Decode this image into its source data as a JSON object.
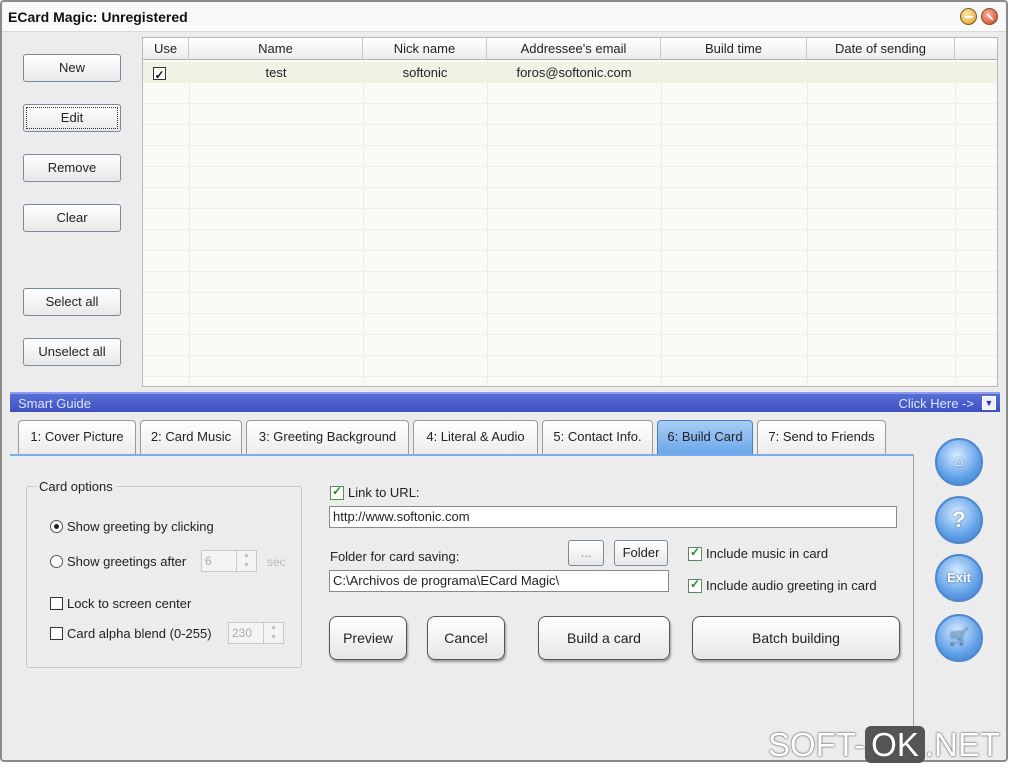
{
  "window": {
    "title": "ECard Magic: Unregistered"
  },
  "left_buttons": {
    "new": "New",
    "edit": "Edit",
    "remove": "Remove",
    "clear": "Clear",
    "select_all": "Select all",
    "unselect_all": "Unselect all"
  },
  "grid": {
    "columns": [
      "Use",
      "Name",
      "Nick name",
      "Addressee's email",
      "Build time",
      "Date of sending"
    ],
    "rows": [
      {
        "use": true,
        "name": "test",
        "nick": "softonic",
        "email": "foros@softonic.com",
        "build_time": "",
        "date_sent": ""
      }
    ]
  },
  "guide": {
    "label": "Smart Guide",
    "click_here": "Click Here ->"
  },
  "tabs": [
    {
      "label": "1: Cover Picture",
      "active": false
    },
    {
      "label": "2: Card Music",
      "active": false
    },
    {
      "label": "3: Greeting Background",
      "active": false
    },
    {
      "label": "4: Literal & Audio",
      "active": false
    },
    {
      "label": "5: Contact Info.",
      "active": false
    },
    {
      "label": "6: Build Card",
      "active": true
    },
    {
      "label": "7: Send to Friends",
      "active": false
    }
  ],
  "card_options": {
    "title": "Card options",
    "show_by_clicking": "Show greeting by clicking",
    "show_after": "Show greetings after",
    "show_after_value": "6",
    "sec": "sec",
    "lock_center": "Lock to screen center",
    "alpha_blend": "Card alpha blend (0-255)",
    "alpha_value": "230",
    "selected": "show_by_clicking",
    "lock_center_checked": false,
    "alpha_blend_checked": false
  },
  "build": {
    "link_url_label": "Link to URL:",
    "link_url_checked": true,
    "link_url_value": "http://www.softonic.com",
    "folder_label": "Folder for card saving:",
    "browse": "...",
    "folder_button": "Folder",
    "folder_value": "C:\\Archivos de programa\\ECard Magic\\",
    "include_music": "Include music in card",
    "include_music_checked": true,
    "include_audio": "Include audio greeting in card",
    "include_audio_checked": true,
    "preview": "Preview",
    "cancel": "Cancel",
    "build_card": "Build a card",
    "batch": "Batch building"
  },
  "side_icons": {
    "home": "home-icon",
    "help": "help-icon",
    "exit": "Exit",
    "cart": "cart-icon"
  },
  "watermark": {
    "left": "SOFT-",
    "ok": "OK",
    "right": ".NET"
  }
}
